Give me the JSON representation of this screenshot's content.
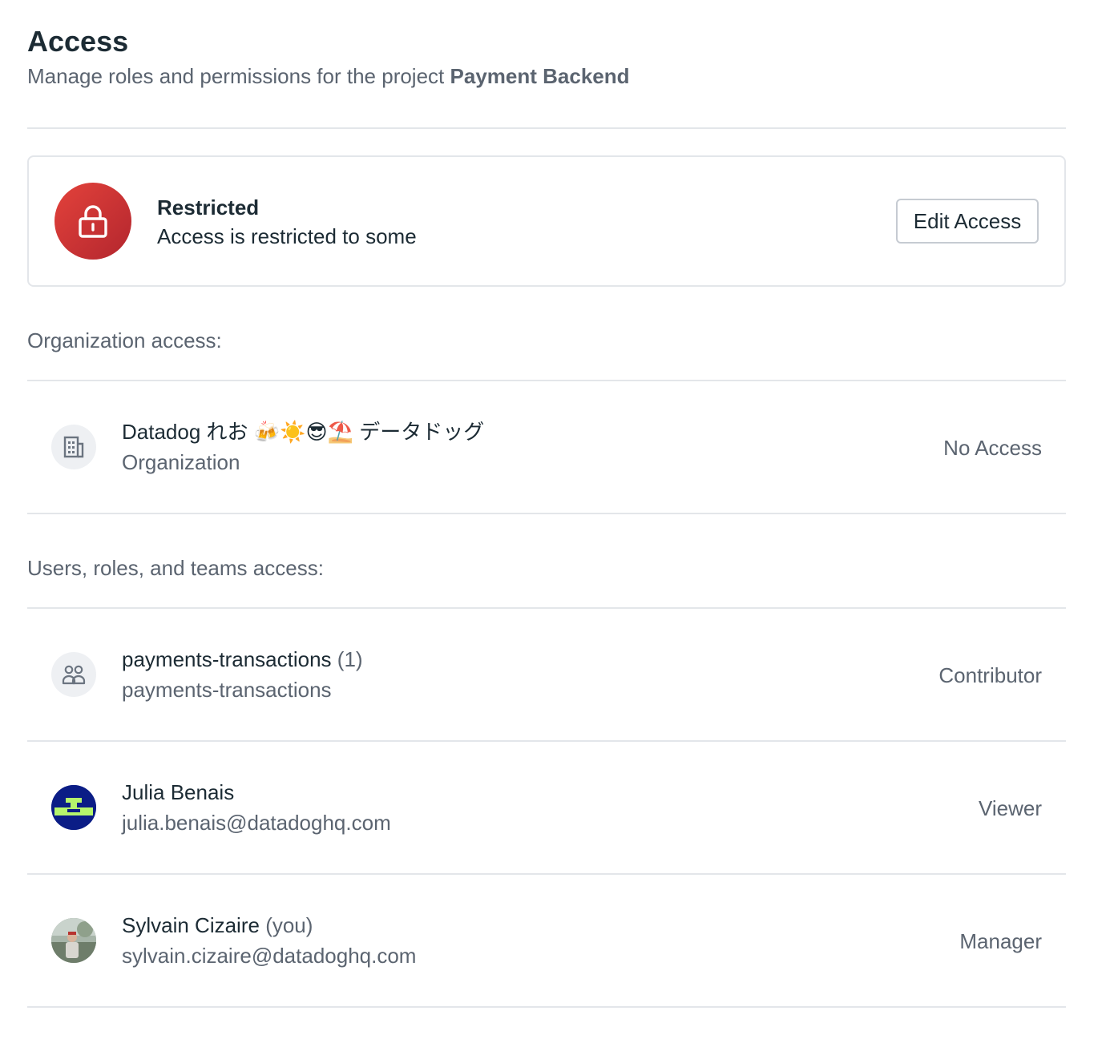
{
  "header": {
    "title": "Access",
    "subtitle_prefix": "Manage roles and permissions for the project",
    "project_name": "Payment Backend"
  },
  "status": {
    "title": "Restricted",
    "description": "Access is restricted to some",
    "edit_label": "Edit Access",
    "icon": "lock-icon",
    "badge_color": "#d33a35"
  },
  "org_section": {
    "label": "Organization access:",
    "items": [
      {
        "name": "Datadog れお 🍻☀️😎⛱️ データドッグ",
        "sub": "Organization",
        "role": "No Access",
        "icon": "building-icon"
      }
    ]
  },
  "users_section": {
    "label": "Users, roles, and teams access:",
    "items": [
      {
        "name": "payments-transactions",
        "name_suffix": "(1)",
        "sub": "payments-transactions",
        "role": "Contributor",
        "icon": "team-icon"
      },
      {
        "name": "Julia Benais",
        "name_suffix": "",
        "sub": "julia.benais@datadoghq.com",
        "role": "Viewer",
        "icon": "pixel-avatar"
      },
      {
        "name": "Sylvain Cizaire",
        "name_suffix": "(you)",
        "sub": "sylvain.cizaire@datadoghq.com",
        "role": "Manager",
        "icon": "photo-avatar"
      }
    ]
  }
}
